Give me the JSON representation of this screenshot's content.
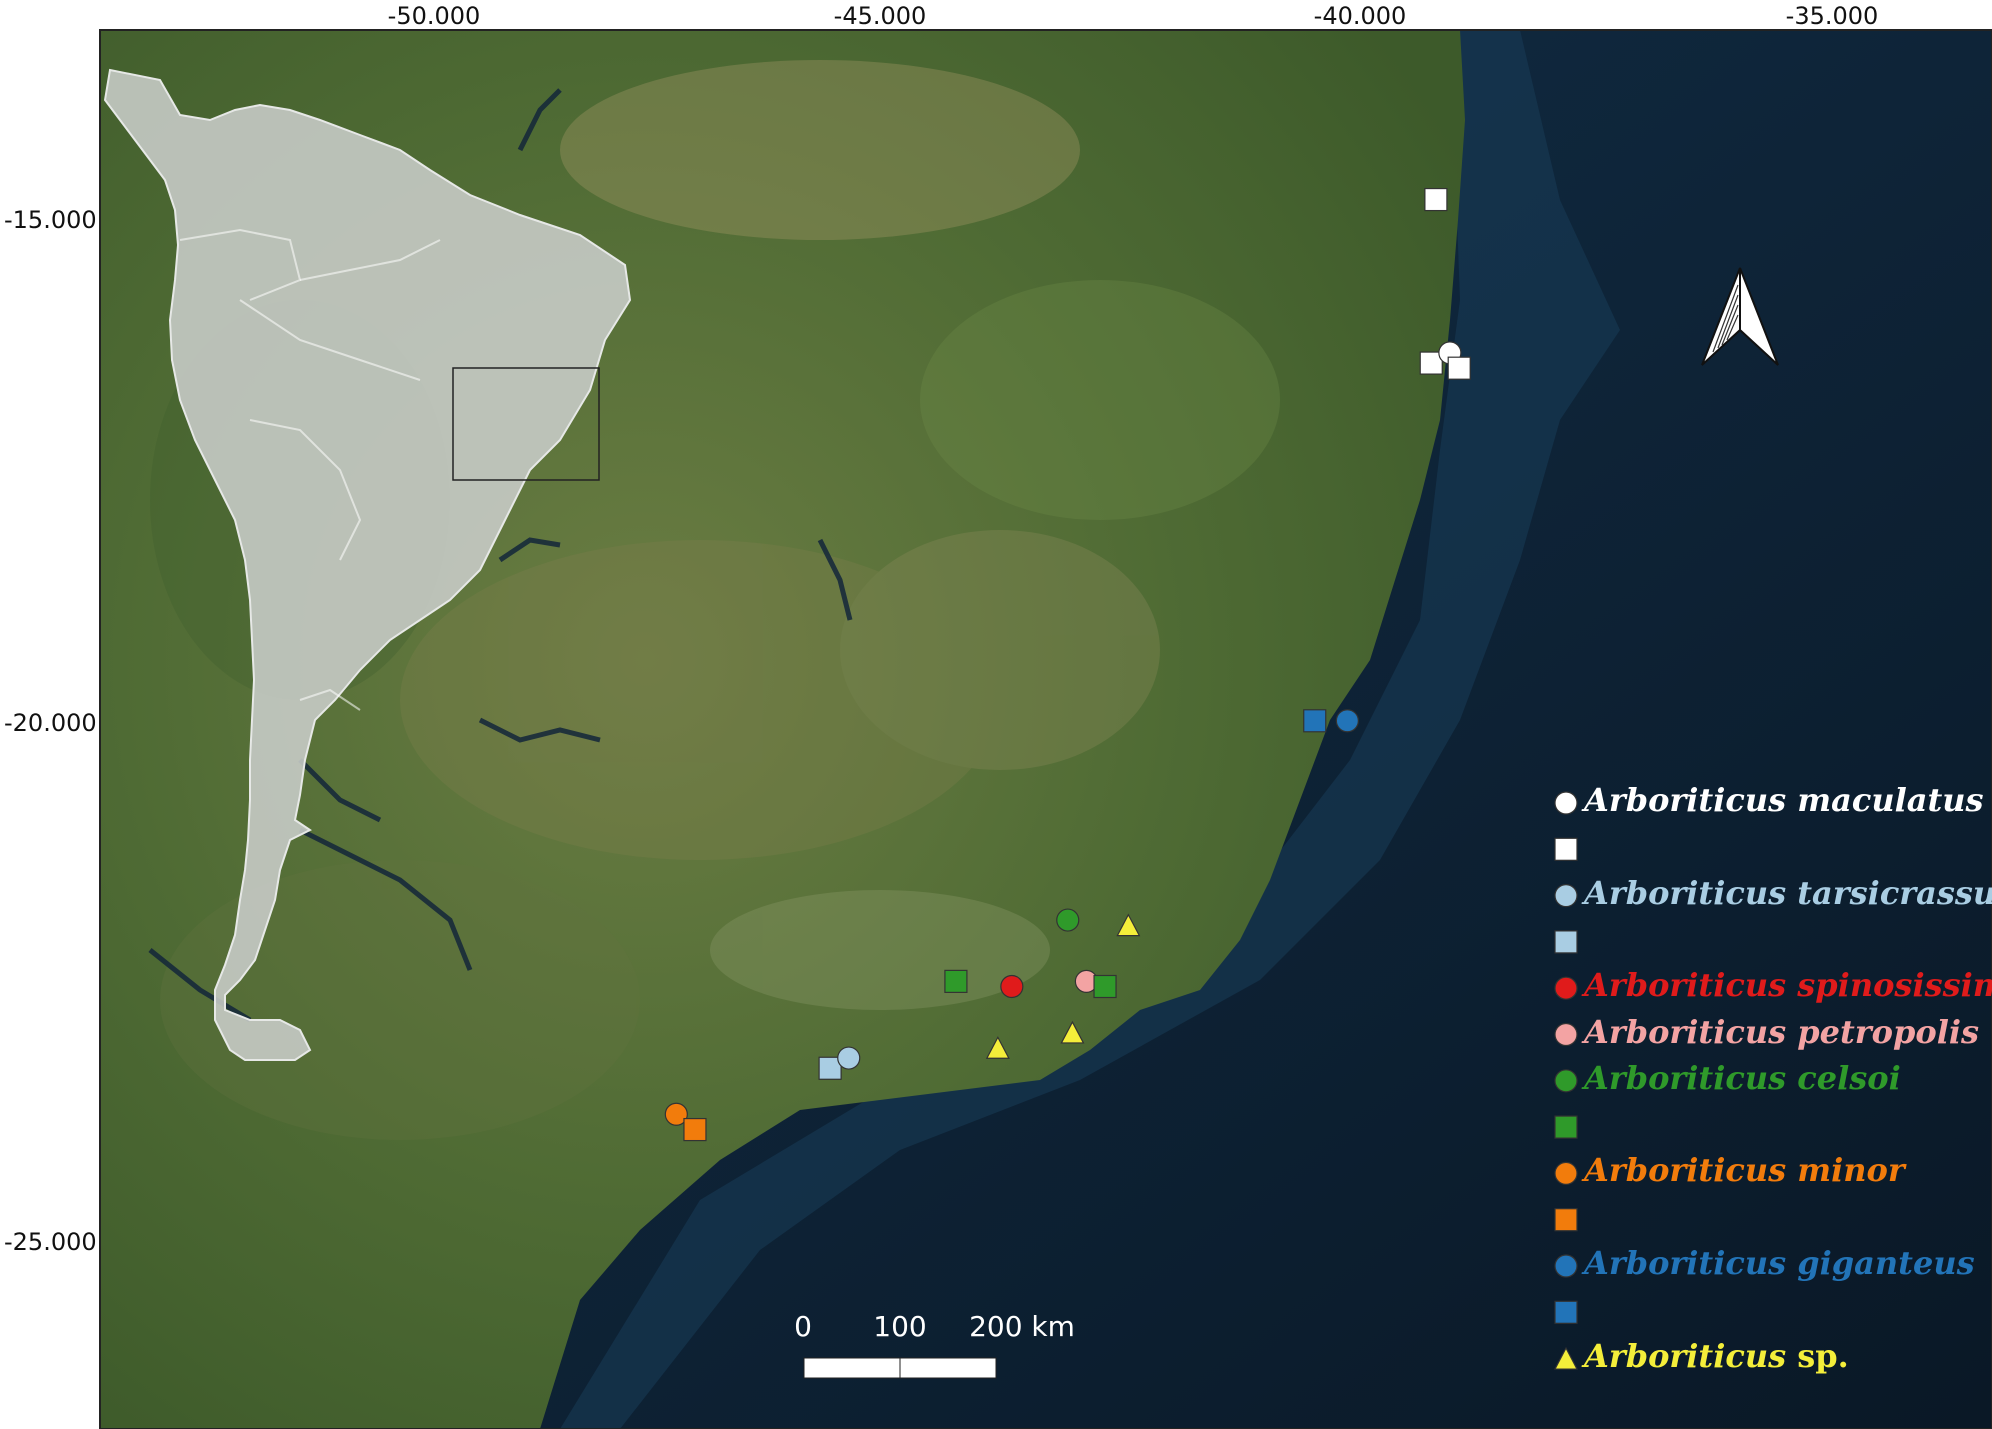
{
  "axes": {
    "x_labels": [
      "-50.000",
      "-45.000",
      "-40.000",
      "-35.000"
    ],
    "y_labels": [
      "-15.000",
      "-20.000",
      "-25.000"
    ]
  },
  "scale_bar": {
    "labels": [
      "0",
      "100",
      "200 km"
    ]
  },
  "north_arrow": {
    "icon": "north-arrow-icon"
  },
  "inset": {
    "content": "south-america-outline",
    "extent_box": true
  },
  "colors": {
    "ocean": "#0c1e30",
    "land": "#4d6a33",
    "inset": "#c9cdca",
    "white": "#ffffff",
    "lightblue": "#a9cde3",
    "red": "#e01b1b",
    "pink": "#f3a3a3",
    "green": "#2f9a2a",
    "orange": "#f27c0c",
    "blue": "#2274b8",
    "yellow": "#f4ee3a"
  },
  "legend": [
    {
      "shape": "circle",
      "color": "#ffffff",
      "genus": "Arboriticus",
      "epithet": "maculatus",
      "suffix": ""
    },
    {
      "shape": "square",
      "color": "#ffffff",
      "genus": "",
      "epithet": "",
      "suffix": ""
    },
    {
      "shape": "circle",
      "color": "#a9cde3",
      "genus": "Arboriticus",
      "epithet": "tarsicrassus",
      "suffix": ""
    },
    {
      "shape": "square",
      "color": "#a9cde3",
      "genus": "",
      "epithet": "",
      "suffix": ""
    },
    {
      "shape": "circle",
      "color": "#e01b1b",
      "genus": "Arboriticus",
      "epithet": "spinosissimus",
      "suffix": ""
    },
    {
      "shape": "circle",
      "color": "#f3a3a3",
      "genus": "Arboriticus",
      "epithet": "petropolis",
      "suffix": ""
    },
    {
      "shape": "circle",
      "color": "#2f9a2a",
      "genus": "Arboriticus",
      "epithet": "celsoi",
      "suffix": ""
    },
    {
      "shape": "square",
      "color": "#2f9a2a",
      "genus": "",
      "epithet": "",
      "suffix": ""
    },
    {
      "shape": "circle",
      "color": "#f27c0c",
      "genus": "Arboriticus",
      "epithet": "minor",
      "suffix": ""
    },
    {
      "shape": "square",
      "color": "#f27c0c",
      "genus": "",
      "epithet": "",
      "suffix": ""
    },
    {
      "shape": "circle",
      "color": "#2274b8",
      "genus": "Arboriticus",
      "epithet": "giganteus",
      "suffix": ""
    },
    {
      "shape": "square",
      "color": "#2274b8",
      "genus": "",
      "epithet": "",
      "suffix": ""
    },
    {
      "shape": "triangle",
      "color": "#f4ee3a",
      "genus": "Arboriticus",
      "epithet": "",
      "suffix": "sp."
    }
  ],
  "localities": [
    {
      "species": "maculatus",
      "shape": "square",
      "color": "#ffffff",
      "lon": -39.25,
      "lat": -14.8
    },
    {
      "species": "maculatus",
      "shape": "square",
      "color": "#ffffff",
      "lon": -39.3,
      "lat": -16.4
    },
    {
      "species": "maculatus",
      "shape": "circle",
      "color": "#ffffff",
      "lon": -39.1,
      "lat": -16.3
    },
    {
      "species": "maculatus",
      "shape": "square",
      "color": "#ffffff",
      "lon": -39.0,
      "lat": -16.45
    },
    {
      "species": "giganteus",
      "shape": "square",
      "color": "#2274b8",
      "lon": -40.55,
      "lat": -19.9
    },
    {
      "species": "giganteus",
      "shape": "circle",
      "color": "#2274b8",
      "lon": -40.2,
      "lat": -19.9
    },
    {
      "species": "celsoi",
      "shape": "circle",
      "color": "#2f9a2a",
      "lon": -43.2,
      "lat": -21.85
    },
    {
      "species": "sp",
      "shape": "triangle",
      "color": "#f4ee3a",
      "lon": -42.55,
      "lat": -21.9
    },
    {
      "species": "celsoi",
      "shape": "square",
      "color": "#2f9a2a",
      "lon": -44.4,
      "lat": -22.45
    },
    {
      "species": "spinosissimus",
      "shape": "circle",
      "color": "#e01b1b",
      "lon": -43.8,
      "lat": -22.5
    },
    {
      "species": "petropolis",
      "shape": "circle",
      "color": "#f3a3a3",
      "lon": -43.0,
      "lat": -22.45
    },
    {
      "species": "celsoi",
      "shape": "square",
      "color": "#2f9a2a",
      "lon": -42.8,
      "lat": -22.5
    },
    {
      "species": "sp",
      "shape": "triangle",
      "color": "#f4ee3a",
      "lon": -43.15,
      "lat": -22.95
    },
    {
      "species": "sp",
      "shape": "triangle",
      "color": "#f4ee3a",
      "lon": -43.95,
      "lat": -23.1
    },
    {
      "species": "tarsicrassus",
      "shape": "square",
      "color": "#a9cde3",
      "lon": -45.75,
      "lat": -23.3
    },
    {
      "species": "tarsicrassus",
      "shape": "circle",
      "color": "#a9cde3",
      "lon": -45.55,
      "lat": -23.2
    },
    {
      "species": "minor",
      "shape": "circle",
      "color": "#f27c0c",
      "lon": -47.4,
      "lat": -23.75
    },
    {
      "species": "minor",
      "shape": "square",
      "color": "#f27c0c",
      "lon": -47.2,
      "lat": -23.9
    }
  ]
}
